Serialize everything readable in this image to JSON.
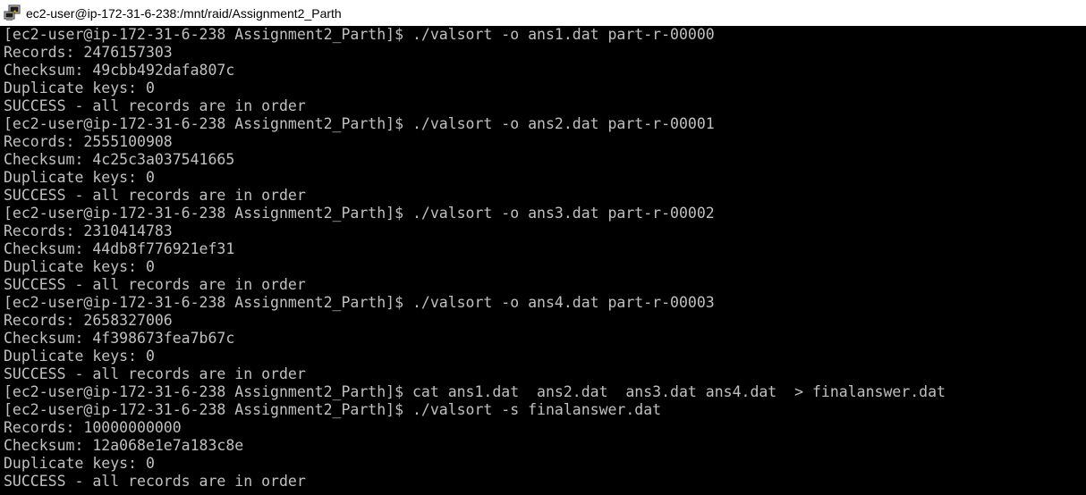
{
  "window": {
    "title": "ec2-user@ip-172-31-6-238:/mnt/raid/Assignment2_Parth",
    "icon": "putty-terminal-icon"
  },
  "colors": {
    "terminal_background": "#000000",
    "terminal_text": "#c0c0c0",
    "titlebar_background": "#ffffff"
  },
  "terminal": {
    "lines": [
      "[ec2-user@ip-172-31-6-238 Assignment2_Parth]$ ./valsort -o ans1.dat part-r-00000",
      "Records: 2476157303",
      "Checksum: 49cbb492dafa807c",
      "Duplicate keys: 0",
      "SUCCESS - all records are in order",
      "[ec2-user@ip-172-31-6-238 Assignment2_Parth]$ ./valsort -o ans2.dat part-r-00001",
      "Records: 2555100908",
      "Checksum: 4c25c3a037541665",
      "Duplicate keys: 0",
      "SUCCESS - all records are in order",
      "[ec2-user@ip-172-31-6-238 Assignment2_Parth]$ ./valsort -o ans3.dat part-r-00002",
      "Records: 2310414783",
      "Checksum: 44db8f776921ef31",
      "Duplicate keys: 0",
      "SUCCESS - all records are in order",
      "[ec2-user@ip-172-31-6-238 Assignment2_Parth]$ ./valsort -o ans4.dat part-r-00003",
      "Records: 2658327006",
      "Checksum: 4f398673fea7b67c",
      "Duplicate keys: 0",
      "SUCCESS - all records are in order",
      "[ec2-user@ip-172-31-6-238 Assignment2_Parth]$ cat ans1.dat  ans2.dat  ans3.dat ans4.dat  > finalanswer.dat",
      "[ec2-user@ip-172-31-6-238 Assignment2_Parth]$ ./valsort -s finalanswer.dat",
      "Records: 10000000000",
      "Checksum: 12a068e1e7a183c8e",
      "Duplicate keys: 0",
      "SUCCESS - all records are in order"
    ]
  }
}
